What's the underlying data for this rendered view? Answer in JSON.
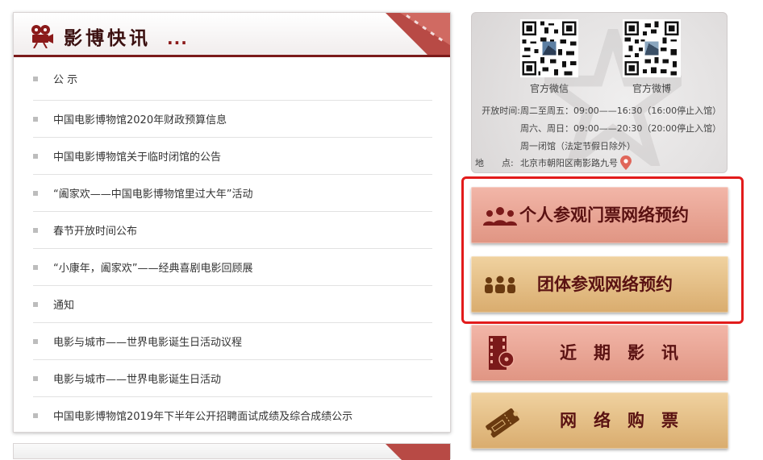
{
  "news": {
    "title": "影博快讯",
    "more": "...",
    "items": [
      "公 示",
      "中国电影博物馆2020年财政预算信息",
      "中国电影博物馆关于临时闭馆的公告",
      "“阖家欢——中国电影博物馆里过大年”活动",
      "春节开放时间公布",
      "“小康年，阖家欢”——经典喜剧电影回顾展",
      "通知",
      "电影与城市——世界电影诞生日活动议程",
      "电影与城市——世界电影诞生日活动",
      "中国电影博物馆2019年下半年公开招聘面试成绩及综合成绩公示"
    ]
  },
  "info": {
    "wechat_label": "官方微信",
    "weibo_label": "官方微博",
    "hours": [
      {
        "label": "开放时间:",
        "text": "周二至周五：09:00——16:30（16:00停止入馆）"
      },
      {
        "label": "",
        "text": "周六、周日：09:00——20:30（20:00停止入馆）"
      },
      {
        "label": "",
        "text": "周一闭馆（法定节假日除外）"
      }
    ],
    "address_label": "地　　点:",
    "address": "北京市朝阳区南影路九号"
  },
  "buttons": {
    "individual": "个人参观门票网络预约",
    "group": "团体参观网络预约",
    "recent": "近　期　影　讯",
    "tickets": "网　络　购　票"
  },
  "colors": {
    "accent": "#7b1a1a",
    "highlight_border": "#e21b1b",
    "pink_button": "#e8a392",
    "tan_button": "#e3bd85"
  }
}
